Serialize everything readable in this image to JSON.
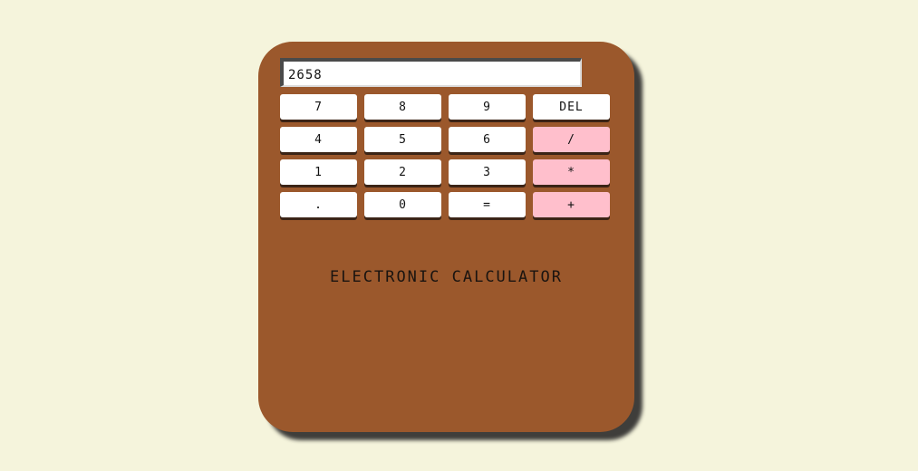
{
  "display": {
    "value": "2658"
  },
  "keys": {
    "seven": "7",
    "eight": "8",
    "nine": "9",
    "del": "DEL",
    "four": "4",
    "five": "5",
    "six": "6",
    "divide": "/",
    "one": "1",
    "two": "2",
    "three": "3",
    "multiply": "*",
    "dot": ".",
    "zero": "0",
    "equals": "=",
    "plus": "+"
  },
  "brand_label": "ELECTRONIC CALCULATOR",
  "colors": {
    "page_background": "#f5f4dc",
    "body": "#9b582c",
    "key": "#ffffff",
    "operator_key": "#ffbfcc"
  }
}
